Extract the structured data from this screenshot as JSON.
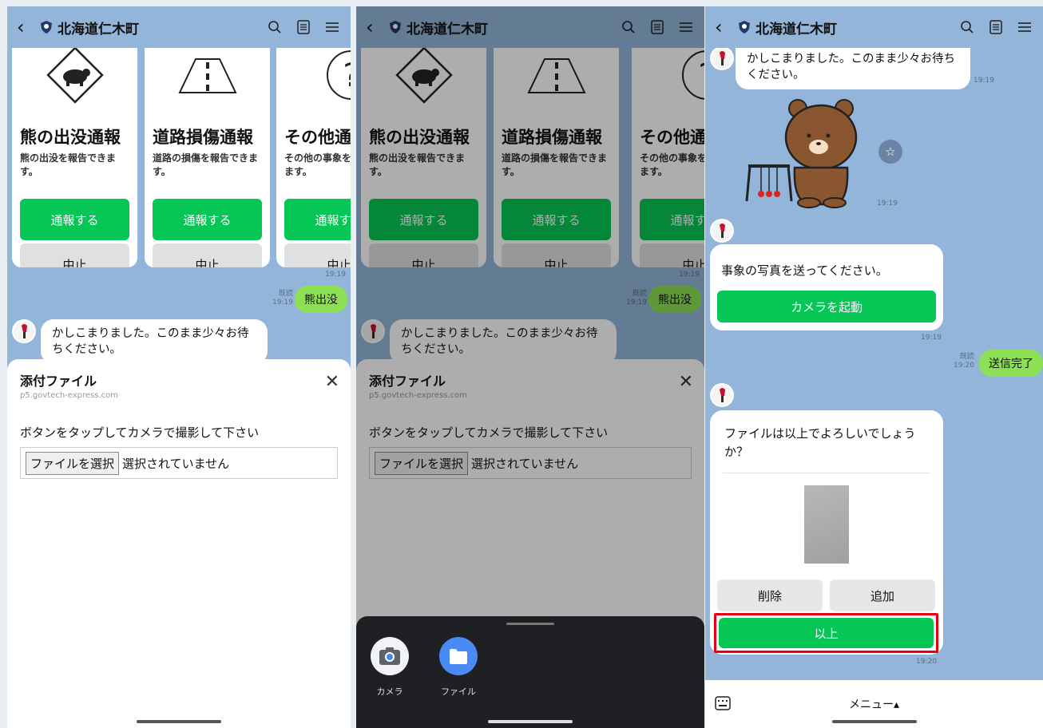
{
  "header": {
    "title": "北海道仁木町"
  },
  "cards": [
    {
      "title": "熊の出没通報",
      "desc": "熊の出没を報告できます。",
      "report": "通報する",
      "cancel": "中止"
    },
    {
      "title": "道路損傷通報",
      "desc": "道路の損傷を報告できます。",
      "report": "通報する",
      "cancel": "中止"
    },
    {
      "title": "その他通報",
      "desc": "その他の事象を報告できます。",
      "report": "通報する",
      "cancel": "中止"
    }
  ],
  "chat": {
    "time_cards": "19:19",
    "read_label": "既読",
    "user_msg1": "熊出没",
    "user_msg1_time": "19:19",
    "bot_msg1": "かしこまりました。このまま少々お待ちください。",
    "bot_msg1_time": "19:19",
    "sticker_time": "19:19",
    "photo_request": "事象の写真を送ってください。",
    "camera_button": "カメラを起動",
    "photo_request_time": "19:19",
    "user_msg2": "送信完了",
    "user_msg2_time": "19:20",
    "confirm_question": "ファイルは以上でよろしいでしょうか？",
    "delete_button": "削除",
    "add_button": "追加",
    "done_button": "以上",
    "confirm_time": "19:20"
  },
  "sheet": {
    "title": "添付ファイル",
    "url": "p5.govtech-express.com",
    "prompt": "ボタンをタップしてカメラで撮影して下さい",
    "file_button": "ファイルを選択",
    "file_status": "選択されていません"
  },
  "picker": {
    "camera": "カメラ",
    "files": "ファイル"
  },
  "footer": {
    "menu": "メニュー▴"
  },
  "colors": {
    "chat_bg": "#93b5d9",
    "line_green": "#06c755",
    "bubble_green": "#8de055",
    "highlight": "#e60012"
  }
}
